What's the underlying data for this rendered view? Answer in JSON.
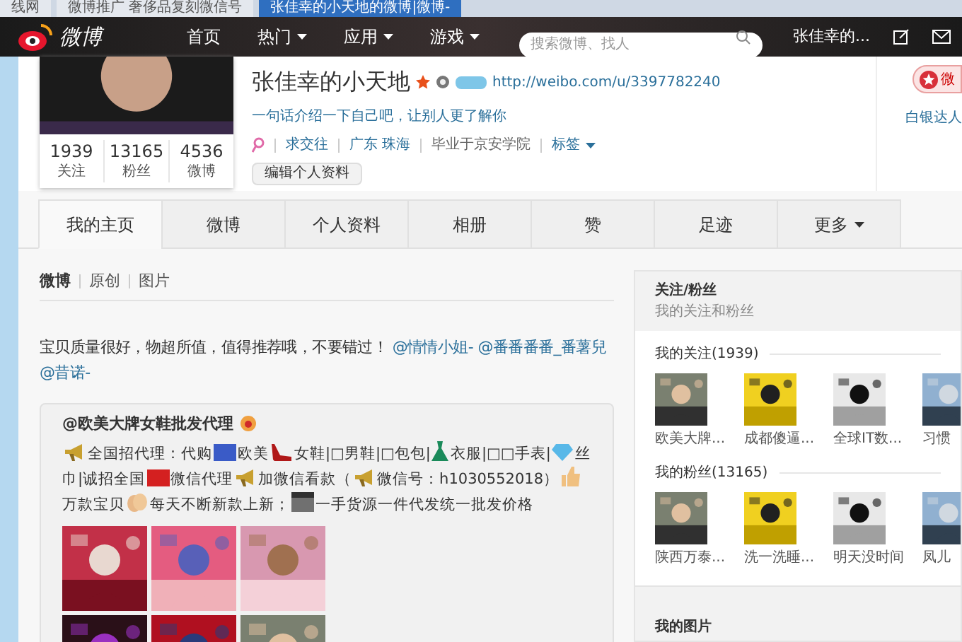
{
  "browser_tabs": [
    {
      "title": "线网",
      "selected": false
    },
    {
      "title": "微博推广 奢侈品复刻微信号",
      "selected": false
    },
    {
      "title": "张佳幸的小天地的微博|微博-",
      "selected": true
    }
  ],
  "nav": {
    "logo": "微博",
    "links": [
      {
        "label": "首页",
        "dropdown": false
      },
      {
        "label": "热门",
        "dropdown": true
      },
      {
        "label": "应用",
        "dropdown": true
      },
      {
        "label": "游戏",
        "dropdown": true
      }
    ],
    "search": {
      "placeholder": "搜索微博、找人"
    },
    "user": "张佳幸的..."
  },
  "profile": {
    "name": "张佳幸的小天地",
    "url": "http://weibo.com/u/3397782240",
    "intro": "一句话介绍一下自己吧，让别人更了解你",
    "info": [
      "求交往",
      "广东 珠海",
      "毕业于京安学院"
    ],
    "tags": "标签",
    "edit_button": "编辑个人资料",
    "stats": [
      {
        "value": "1939",
        "label": "关注"
      },
      {
        "value": "13165",
        "label": "粉丝"
      },
      {
        "value": "4536",
        "label": "微博"
      }
    ],
    "side_button": "微",
    "badge": "白银达人"
  },
  "tabs": [
    {
      "label": "我的主页",
      "selected": true,
      "dropdown": false
    },
    {
      "label": "微博",
      "selected": false,
      "dropdown": false
    },
    {
      "label": "个人资料",
      "selected": false,
      "dropdown": false
    },
    {
      "label": "相册",
      "selected": false,
      "dropdown": false
    },
    {
      "label": "赞",
      "selected": false,
      "dropdown": false
    },
    {
      "label": "足迹",
      "selected": false,
      "dropdown": false
    },
    {
      "label": "更多",
      "selected": false,
      "dropdown": true
    }
  ],
  "sub_tabs": [
    {
      "label": "微博",
      "selected": true
    },
    {
      "label": "原创",
      "selected": false
    },
    {
      "label": "图片",
      "selected": false
    }
  ],
  "post": {
    "text": "宝贝质量很好，物超所值，值得推荐哦，不要错过！",
    "mentions": [
      "@情情小姐-",
      "@番番番番_番薯兒",
      "@昔诺-"
    ]
  },
  "repost": {
    "author": "@欧美大牌女鞋批发代理",
    "content": [
      {
        "kind": "megaphone"
      },
      {
        "kind": "text",
        "text": "全国招代理：代购"
      },
      {
        "kind": "flag",
        "color": "#3a5bc7"
      },
      {
        "kind": "text",
        "text": "欧美"
      },
      {
        "kind": "shoe"
      },
      {
        "kind": "text",
        "text": "女鞋|□男鞋|□包包|"
      },
      {
        "kind": "dress"
      },
      {
        "kind": "text",
        "text": "衣服|□□手表|"
      },
      {
        "kind": "gem"
      },
      {
        "kind": "text",
        "text": "丝巾|诚招全国"
      },
      {
        "kind": "flag",
        "color": "#d42020"
      },
      {
        "kind": "text",
        "text": "微信代理"
      },
      {
        "kind": "megaphone"
      },
      {
        "kind": "text",
        "text": "加微信看款（"
      },
      {
        "kind": "megaphone"
      },
      {
        "kind": "text",
        "text": "微信号：h1030552018）"
      },
      {
        "kind": "thumb"
      },
      {
        "kind": "text",
        "text": "万款宝贝"
      },
      {
        "kind": "hands"
      },
      {
        "kind": "text",
        "text": "每天不断新款上新；"
      },
      {
        "kind": "clapper"
      },
      {
        "kind": "text",
        "text": "一手货源一件代发统一批发价格"
      }
    ]
  },
  "sidebar": {
    "title": "关注/粉丝",
    "subtitle": "我的关注和粉丝",
    "sections": [
      {
        "heading": "我的关注(1939)",
        "users": [
          {
            "name": "欧美大牌..."
          },
          {
            "name": "成都傻逼..."
          },
          {
            "name": "全球IT数..."
          },
          {
            "name": "习惯"
          }
        ]
      },
      {
        "heading": "我的粉丝(13165)",
        "users": [
          {
            "name": "陕西万泰..."
          },
          {
            "name": "洗一洗睡..."
          },
          {
            "name": "明天没时间"
          },
          {
            "name": "凤儿"
          }
        ]
      }
    ],
    "photos_heading": "我的图片"
  }
}
